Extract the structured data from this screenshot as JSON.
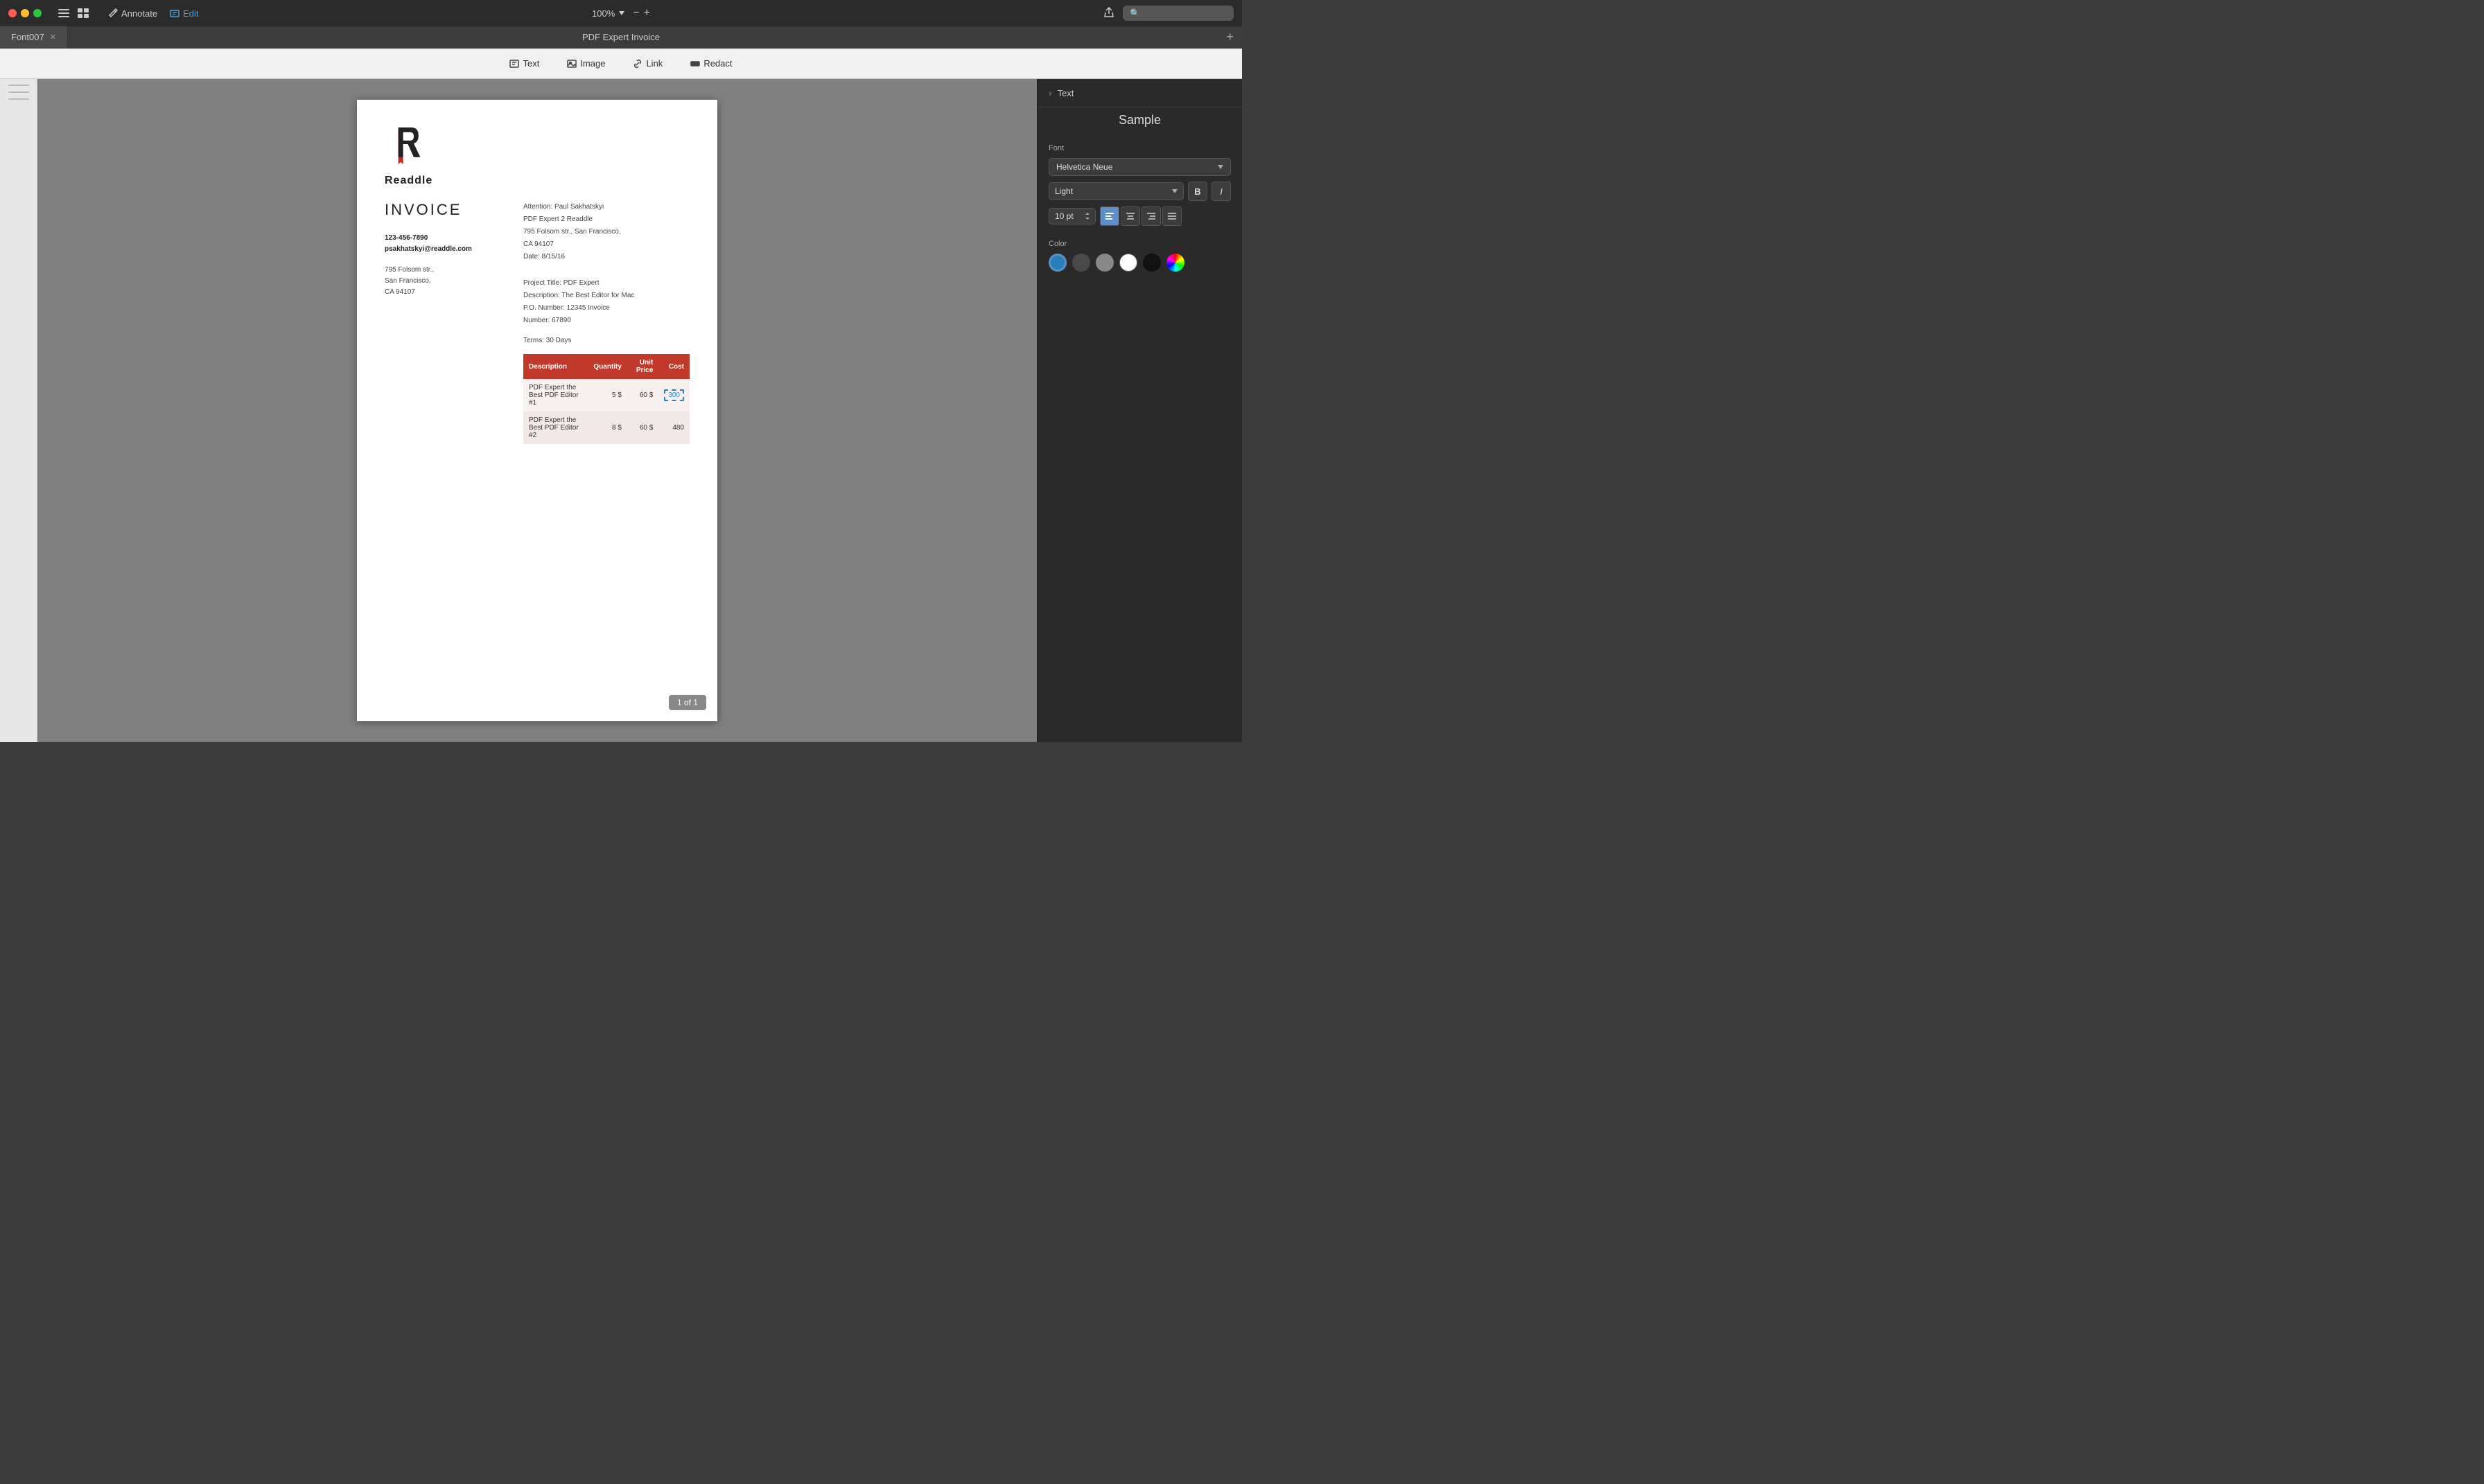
{
  "titlebar": {
    "zoom_label": "100%",
    "window_title": "PDF Expert Invoice",
    "annotate_label": "Annotate",
    "edit_label": "Edit"
  },
  "tabbar": {
    "tab_name": "Font007",
    "window_title": "PDF Expert Invoice",
    "add_tab_label": "+"
  },
  "toolbar": {
    "text_label": "Text",
    "image_label": "Image",
    "link_label": "Link",
    "redact_label": "Redact"
  },
  "pdf": {
    "company": "Readdle",
    "invoice_title": "INVOICE",
    "phone": "123-456-7890",
    "email": "psakhatskyi@readdle.com",
    "address_line1": "795 Folsom str.,",
    "address_line2": "San Francisco,",
    "address_line3": "CA 94107",
    "attention": "Attention: Paul Sakhatskyi",
    "bill_to": "PDF Expert 2 Readdle",
    "bill_address": "795 Folsom str., San Francisco,",
    "bill_city": "CA 94107",
    "date": "Date: 8/15/16",
    "project_title": "Project Title: PDF Expert",
    "description": "Description: The Best Editor for Mac",
    "po_number": "P.O. Number: 12345 Invoice",
    "invoice_number": "Number: 67890",
    "terms": "Terms: 30 Days",
    "table": {
      "headers": [
        "Description",
        "Quantity",
        "Unit Price",
        "Cost"
      ],
      "rows": [
        {
          "desc": "PDF Expert the Best PDF Editor #1",
          "qty": "5",
          "currency1": "$",
          "unit_price": "60",
          "currency2": "$",
          "cost": "300",
          "highlighted": true
        },
        {
          "desc": "PDF Expert the Best PDF Editor #2",
          "qty": "8",
          "currency1": "$",
          "unit_price": "60",
          "currency2": "$",
          "cost": "480",
          "highlighted": false
        }
      ]
    },
    "page_number": "1 of 1"
  },
  "right_panel": {
    "panel_title": "Text",
    "sample_label": "Sample",
    "font_section_label": "Font",
    "font_name": "Helvetica Neue",
    "font_weight": "Light",
    "bold_label": "B",
    "italic_label": "I",
    "size_label": "10 pt",
    "align_buttons": [
      "left",
      "center",
      "right",
      "justify"
    ],
    "color_section_label": "Color",
    "colors": [
      {
        "name": "blue",
        "hex": "#2980b9",
        "selected": true
      },
      {
        "name": "dark-gray",
        "hex": "#4a4a4a",
        "selected": false
      },
      {
        "name": "medium-gray",
        "hex": "#888888",
        "selected": false
      },
      {
        "name": "white",
        "hex": "#ffffff",
        "selected": false
      },
      {
        "name": "black",
        "hex": "#111111",
        "selected": false
      }
    ]
  }
}
